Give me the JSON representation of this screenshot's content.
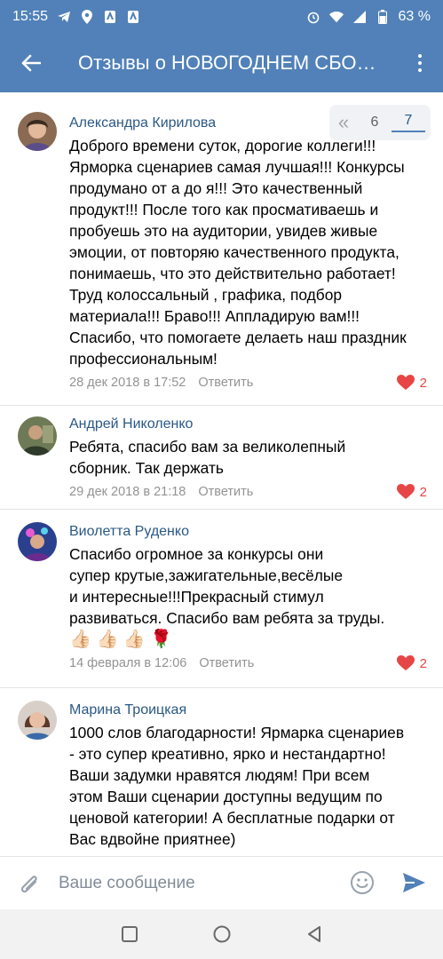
{
  "status_bar": {
    "time": "15:55",
    "battery": "63 %",
    "icons": [
      "telegram-icon",
      "location-icon",
      "app-icon",
      "app-icon",
      "alarm-icon",
      "wifi-icon",
      "signal-icon",
      "battery-icon"
    ]
  },
  "app_bar": {
    "title": "Отзывы о НОВОГОДНЕМ СБОРНИКЕ",
    "back_icon": "arrow-left-icon",
    "menu_icon": "more-vertical-icon"
  },
  "pager": {
    "prev_label": "«",
    "pages": [
      "6",
      "7"
    ],
    "active_page": "7"
  },
  "comments": [
    {
      "author": "Александра Кирилова",
      "text": "Доброго времени суток, дорогие коллеги!!!\nЯрморка сценариев самая лучшая!!! Конкурсы\nпродумано от а до я!!! Это качественный\nпродукт!!! После того как просмативаешь и\nпробуешь это на аудитории, увидев живые\nэмоции, от повторяю качественного продукта,\nпонимаешь, что это действительно работает!\nТруд колоссальный , графика, подбор\nматериала!!! Браво!!! Аппладирую вам!!!\nСпасибо, что помогаете делаеть наш праздник\nпрофессиональным!",
      "date": "28 дек 2018 в 17:52",
      "reply_label": "Ответить",
      "likes": "2"
    },
    {
      "author": "Андрей Николенко",
      "text": "Ребята, спасибо вам за великолепный\nсборник. Так держать",
      "date": "29 дек 2018 в 21:18",
      "reply_label": "Ответить",
      "likes": "2"
    },
    {
      "author": "Виолетта Руденко",
      "text": "Спасибо огромное за конкурсы они\nсупер крутые,зажигательные,весёлые\nи интересные!!!Прекрасный стимул\nразвиваться. Спасибо вам ребята за труды.",
      "emojis": "👍🏻 👍🏻 👍🏻 🌹",
      "date": "14 февраля в 12:06",
      "reply_label": "Ответить",
      "likes": "2"
    },
    {
      "author": "Марина Троицкая",
      "text": "1000 слов благодарности! Ярмарка сценариев\n- это супер креативно, ярко и нестандартно!\nВаши задумки нравятся людям! При всем\nэтом Ваши сценарии доступны ведущим по\nценовой категории! А бесплатные подарки от\nВас вдвойне приятнее)",
      "date": "",
      "reply_label": "",
      "likes": ""
    }
  ],
  "composer": {
    "placeholder": "Ваше сообщение",
    "attach_icon": "paperclip-icon",
    "emoji_icon": "smile-icon",
    "send_icon": "send-icon"
  },
  "nav_bar": {
    "icons": [
      "recent-apps-icon",
      "home-icon",
      "back-triangle-icon"
    ]
  },
  "colors": {
    "brand": "#5181b8",
    "author": "#2a5885",
    "like": "#e64646",
    "meta": "#939393"
  }
}
